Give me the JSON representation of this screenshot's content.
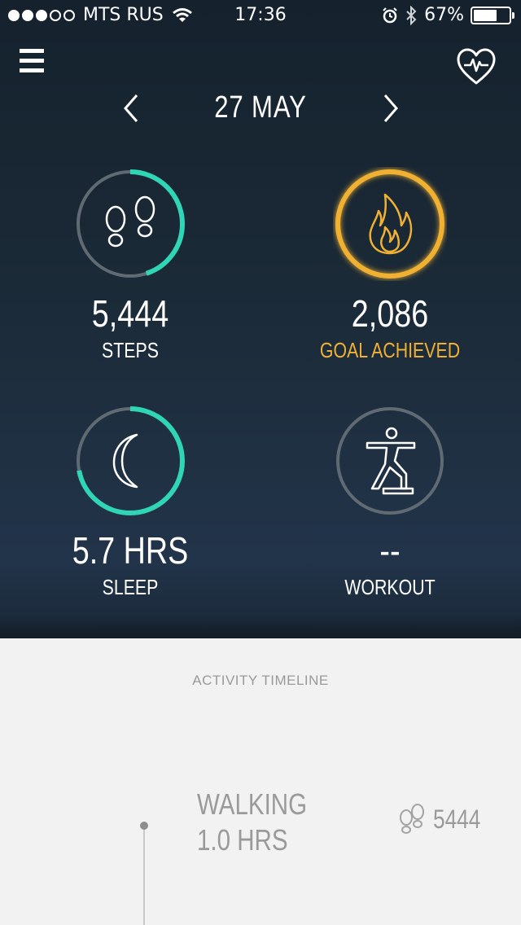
{
  "status_bar": {
    "signal_dots_filled": 3,
    "signal_dots_total": 5,
    "carrier": "MTS RUS",
    "time": "17:36",
    "battery": "67%",
    "battery_level": 0.67
  },
  "header": {
    "menu_icon": "hamburger-menu-icon",
    "health_icon": "heart-pulse-icon",
    "date": "27 MAY"
  },
  "stats": {
    "steps": {
      "value": "5,444",
      "label": "STEPS",
      "icon": "footprints-icon",
      "progress": 0.45,
      "color": "#2fd5b4"
    },
    "calories": {
      "value": "2,086",
      "label": "GOAL ACHIEVED",
      "icon": "flame-icon",
      "progress": 1.0,
      "color": "#f0b133"
    },
    "sleep": {
      "value": "5.7 HRS",
      "label": "SLEEP",
      "icon": "moon-icon",
      "progress": 0.72,
      "color": "#2fd5b4"
    },
    "workout": {
      "value": "--",
      "label": "WORKOUT",
      "icon": "surfing-figure-icon",
      "progress": 0,
      "color": "#5f6a73"
    }
  },
  "timeline": {
    "title": "ACTIVITY TIMELINE",
    "entries": [
      {
        "activity": "WALKING",
        "duration": "1.0 HRS",
        "steps": "5444",
        "icon": "footprints-icon"
      }
    ]
  }
}
